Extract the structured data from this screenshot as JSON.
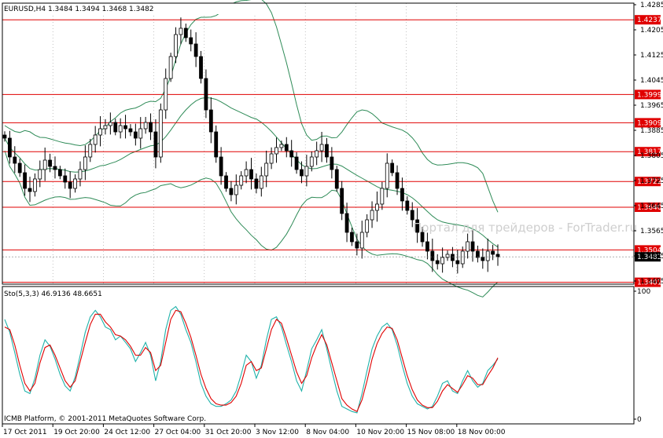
{
  "header": {
    "price_title": "EURUSD,H4  1.3484 1.3494 1.3468 1.3482",
    "indicator_title": "Sto(5,3,3) 46.9136 48.6651"
  },
  "watermark": "Портал для трейдеров - ForTrader.ru",
  "copyright": "ICMB Platform, © 2001-2011 MetaQuotes Software Corp.",
  "colors": {
    "background": "#ffffff",
    "candle": "#000000",
    "bands": "#2e8b57",
    "level_line": "#e00000",
    "level_label_bg": "#e00000",
    "level_label_text": "#ffffff",
    "current_price_bg": "#000000",
    "stoch_main": "#20b2aa",
    "stoch_signal": "#e00000",
    "grid": "#9a9a9a"
  },
  "chart_data": [
    {
      "type": "candlestick",
      "symbol": "EURUSD",
      "timeframe": "H4",
      "ohlc_current": {
        "open": 1.3484,
        "high": 1.3494,
        "low": 1.3468,
        "close": 1.3482
      },
      "current_price_label": "1.3482",
      "ylim": [
        1.3395,
        1.429
      ],
      "y_ticks": [
        {
          "value": 1.4285,
          "label": "1.4285"
        },
        {
          "value": 1.4205,
          "label": "1.4205"
        },
        {
          "value": 1.4125,
          "label": "1.4125"
        },
        {
          "value": 1.4045,
          "label": "1.4045"
        },
        {
          "value": 1.3965,
          "label": "1.3965"
        },
        {
          "value": 1.3885,
          "label": "1.3885"
        },
        {
          "value": 1.3805,
          "label": "1.3805"
        },
        {
          "value": 1.3725,
          "label": "1.3725"
        },
        {
          "value": 1.3645,
          "label": "1.3645"
        },
        {
          "value": 1.3565,
          "label": "1.3565"
        },
        {
          "value": 1.3485,
          "label": "1.3485"
        },
        {
          "value": 1.3405,
          "label": "1.3405"
        }
      ],
      "levels": [
        {
          "value": 1.4237,
          "label": "1.4237"
        },
        {
          "value": 1.3999,
          "label": "1.3999"
        },
        {
          "value": 1.3909,
          "label": "1.3909"
        },
        {
          "value": 1.3817,
          "label": "1.3817"
        },
        {
          "value": 1.3722,
          "label": "1.3722"
        },
        {
          "value": 1.364,
          "label": "1.3640"
        },
        {
          "value": 1.3504,
          "label": "1.3504"
        },
        {
          "value": 1.3401,
          "label": "1.3401"
        }
      ],
      "x_labels": [
        "17 Oct 2011",
        "19 Oct 20:00",
        "24 Oct 12:00",
        "27 Oct 04:00",
        "31 Oct 20:00",
        "3 Nov 12:00",
        "8 Nov 04:00",
        "10 Nov 20:00",
        "15 Nov 08:00",
        "18 Nov 00:00"
      ],
      "closes": [
        1.386,
        1.38,
        1.378,
        1.375,
        1.37,
        1.369,
        1.373,
        1.376,
        1.379,
        1.377,
        1.376,
        1.374,
        1.372,
        1.37,
        1.373,
        1.376,
        1.38,
        1.384,
        1.387,
        1.389,
        1.39,
        1.391,
        1.388,
        1.39,
        1.389,
        1.388,
        1.386,
        1.389,
        1.391,
        1.388,
        1.38,
        1.395,
        1.405,
        1.412,
        1.419,
        1.421,
        1.418,
        1.416,
        1.412,
        1.405,
        1.395,
        1.388,
        1.38,
        1.374,
        1.37,
        1.368,
        1.371,
        1.374,
        1.376,
        1.373,
        1.37,
        1.374,
        1.378,
        1.381,
        1.383,
        1.384,
        1.382,
        1.38,
        1.376,
        1.374,
        1.377,
        1.38,
        1.382,
        1.384,
        1.38,
        1.376,
        1.37,
        1.362,
        1.356,
        1.353,
        1.351,
        1.356,
        1.36,
        1.363,
        1.365,
        1.37,
        1.378,
        1.375,
        1.37,
        1.366,
        1.363,
        1.36,
        1.356,
        1.353,
        1.35,
        1.347,
        1.346,
        1.348,
        1.349,
        1.347,
        1.346,
        1.35,
        1.353,
        1.35,
        1.348,
        1.347,
        1.35,
        1.349,
        1.3482
      ]
    },
    {
      "type": "line",
      "indicator": "Stochastic",
      "params": "5,3,3",
      "values": {
        "main": 46.9136,
        "signal": 48.6651
      },
      "ylim": [
        0,
        100
      ],
      "y_ticks": [
        {
          "value": 100,
          "label": "100"
        },
        {
          "value": 0,
          "label": "0"
        }
      ],
      "series": [
        {
          "values": [
            78,
            68,
            52,
            35,
            22,
            20,
            32,
            50,
            62,
            57,
            47,
            35,
            26,
            22,
            33,
            50,
            68,
            80,
            85,
            80,
            72,
            70,
            62,
            65,
            60,
            55,
            45,
            52,
            60,
            50,
            30,
            45,
            70,
            85,
            88,
            82,
            70,
            60,
            45,
            28,
            18,
            12,
            10,
            10,
            12,
            15,
            22,
            35,
            50,
            45,
            32,
            42,
            62,
            78,
            80,
            72,
            58,
            45,
            30,
            22,
            38,
            55,
            62,
            70,
            55,
            38,
            22,
            10,
            8,
            6,
            5,
            20,
            38,
            55,
            65,
            72,
            75,
            70,
            58,
            42,
            28,
            18,
            12,
            10,
            8,
            10,
            18,
            28,
            30,
            22,
            20,
            30,
            38,
            30,
            25,
            28,
            38,
            42,
            47
          ]
        },
        {
          "values": [
            72,
            70,
            58,
            42,
            28,
            22,
            28,
            44,
            56,
            58,
            50,
            40,
            30,
            25,
            30,
            45,
            60,
            74,
            82,
            82,
            76,
            72,
            66,
            65,
            62,
            57,
            50,
            50,
            56,
            52,
            38,
            42,
            60,
            78,
            85,
            84,
            75,
            64,
            50,
            35,
            24,
            16,
            12,
            11,
            11,
            13,
            18,
            28,
            42,
            45,
            38,
            40,
            55,
            70,
            78,
            75,
            63,
            50,
            37,
            28,
            34,
            48,
            58,
            66,
            58,
            44,
            30,
            16,
            11,
            8,
            6,
            15,
            30,
            47,
            59,
            67,
            72,
            71,
            62,
            48,
            34,
            23,
            15,
            11,
            9,
            9,
            14,
            22,
            27,
            24,
            21,
            27,
            34,
            32,
            27,
            27,
            34,
            40,
            48
          ]
        }
      ]
    }
  ]
}
